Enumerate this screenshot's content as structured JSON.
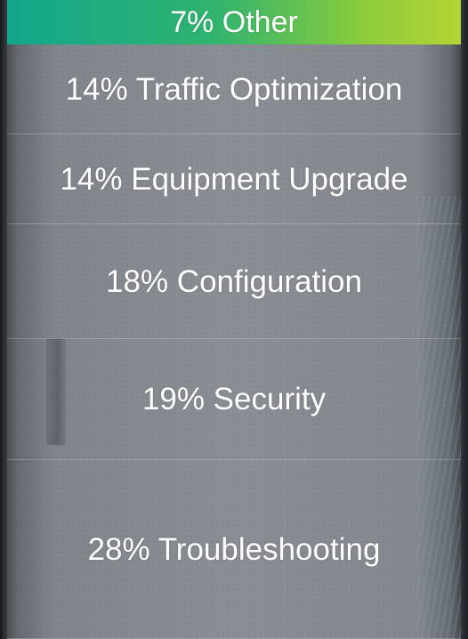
{
  "chart_data": {
    "type": "bar",
    "orientation": "stacked-vertical",
    "categories": [
      "Other",
      "Traffic Optimization",
      "Equipment Upgrade",
      "Configuration",
      "Security",
      "Troubleshooting"
    ],
    "values": [
      7,
      14,
      14,
      18,
      19,
      28
    ],
    "unit": "%",
    "labels": [
      "7% Other",
      "14% Traffic Optimization",
      "14% Equipment Upgrade",
      "18% Configuration",
      "19% Security",
      "28% Troubleshooting"
    ],
    "highlight_index": 0,
    "colors": {
      "highlight_start": "#12a68c",
      "highlight_end": "#b4d435",
      "segment_overlay": "#9b9ea5",
      "text": "#ffffff"
    },
    "title": "",
    "xlabel": "",
    "ylabel": ""
  }
}
